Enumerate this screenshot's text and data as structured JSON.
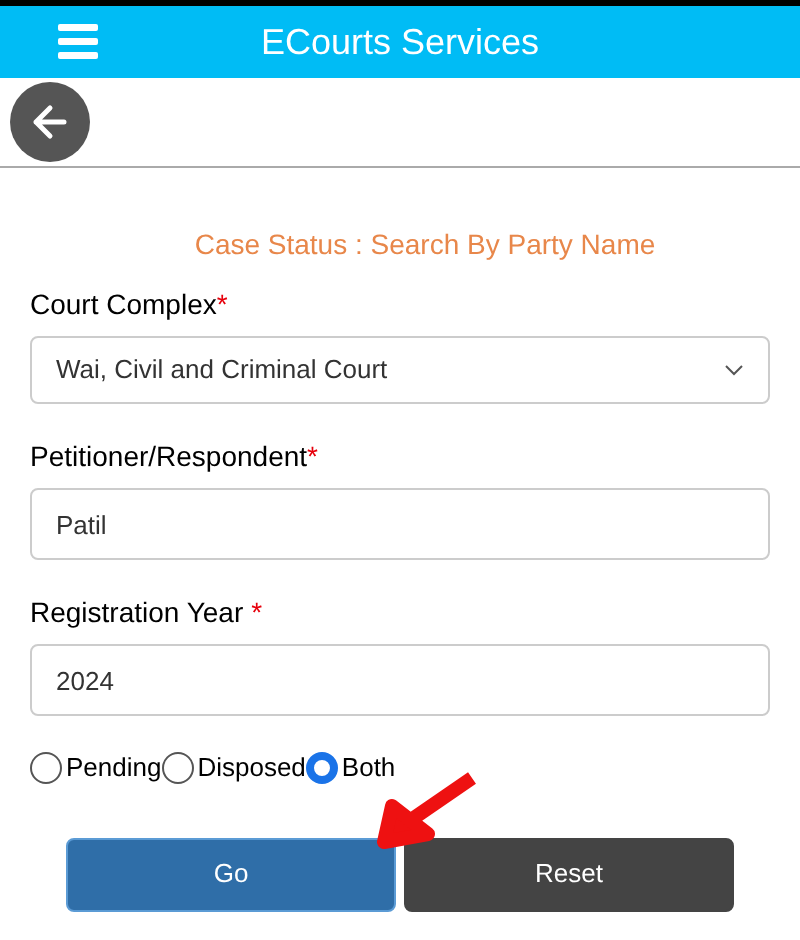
{
  "header": {
    "title": "ECourts Services"
  },
  "page_title": "Case Status : Search By Party Name",
  "fields": [
    {
      "kind": "select",
      "label": "Court Complex",
      "required_mark": "*",
      "value": "Wai, Civil and Criminal Court"
    },
    {
      "kind": "text",
      "label": "Petitioner/Respondent",
      "required_mark": "*",
      "value": "Patil"
    },
    {
      "kind": "text",
      "label": "Registration Year",
      "required_mark": "*",
      "value": "2024"
    }
  ],
  "status_options": [
    {
      "label": "Pending",
      "selected": false
    },
    {
      "label": "Disposed",
      "selected": false
    },
    {
      "label": "Both",
      "selected": true
    }
  ],
  "buttons": [
    {
      "kind": "primary",
      "label": "Go"
    },
    {
      "kind": "secondary",
      "label": "Reset"
    }
  ]
}
